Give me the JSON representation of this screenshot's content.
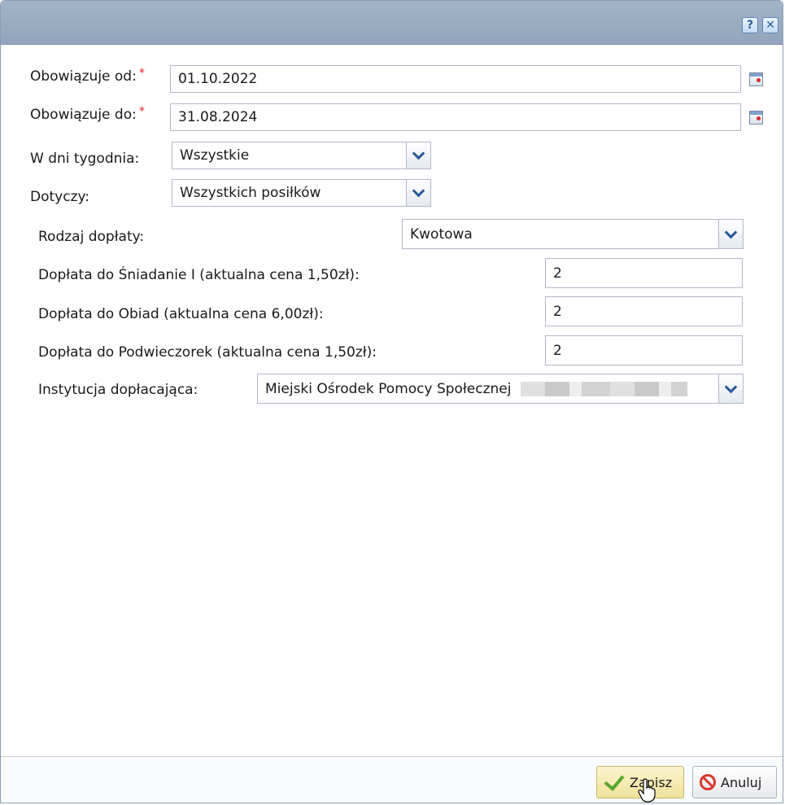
{
  "titlebar": {
    "help_label": "?",
    "close_label": "✕"
  },
  "form": {
    "valid_from": {
      "label": "Obowiązuje od:",
      "required_mark": "*",
      "value": "01.10.2022"
    },
    "valid_to": {
      "label": "Obowiązuje do:",
      "required_mark": "*",
      "value": "31.08.2024"
    },
    "weekdays": {
      "label": "W dni tygodnia:",
      "value": "Wszystkie"
    },
    "applies_to": {
      "label": "Dotyczy:",
      "value": "Wszystkich posiłków"
    },
    "subsidy_type": {
      "label": "Rodzaj dopłaty:",
      "value": "Kwotowa"
    },
    "subsidies": [
      {
        "label": "Dopłata do Śniadanie I (aktualna cena 1,50zł):",
        "value": "2"
      },
      {
        "label": "Dopłata do Obiad (aktualna cena 6,00zł):",
        "value": "2"
      },
      {
        "label": "Dopłata do Podwieczorek (aktualna cena 1,50zł):",
        "value": "2"
      }
    ],
    "institution": {
      "label": "Instytucja dopłacająca:",
      "value": "Miejski Ośrodek Pomocy Społecznej"
    }
  },
  "footer": {
    "save_label": "Zapisz",
    "cancel_label": "Anuluj"
  },
  "colors": {
    "titlebar": "#9aacc2",
    "required": "#e02020",
    "save_bg": "#f5ebb5",
    "accent": "#27579a"
  }
}
